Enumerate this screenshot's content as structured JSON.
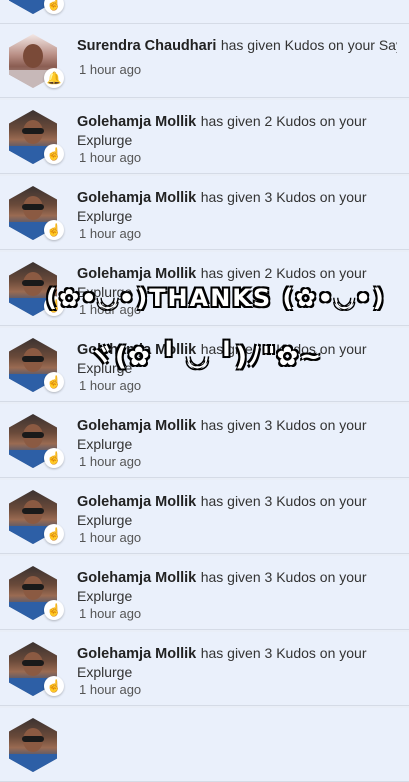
{
  "notifications": [
    {
      "name": "",
      "action": "",
      "target": "",
      "time": ""
    },
    {
      "name": "Surendra Chaudhari",
      "action": "has given Kudos on your Say",
      "target": "",
      "time": "1 hour ago",
      "avatar": "alt"
    },
    {
      "name": "Golehamja Mollik",
      "action": "has given 2 Kudos on your",
      "target": "Explurge",
      "time": "1 hour ago"
    },
    {
      "name": "Golehamja Mollik",
      "action": "has given 3 Kudos on your",
      "target": "Explurge",
      "time": "1 hour ago"
    },
    {
      "name": "Golehamja Mollik",
      "action": "has given 2 Kudos on your",
      "target": "Explurge",
      "time": "1 hour ago"
    },
    {
      "name": "Golehamja Mollik",
      "action": "has given 2 Kudos on your",
      "target": "Explurge",
      "time": "1 hour ago"
    },
    {
      "name": "Golehamja Mollik",
      "action": "has given 3 Kudos on your",
      "target": "Explurge",
      "time": "1 hour ago"
    },
    {
      "name": "Golehamja Mollik",
      "action": "has given 3 Kudos on your",
      "target": "Explurge",
      "time": "1 hour ago"
    },
    {
      "name": "Golehamja Mollik",
      "action": "has given 3 Kudos on your",
      "target": "Explurge",
      "time": "1 hour ago"
    },
    {
      "name": "Golehamja Mollik",
      "action": "has given 3 Kudos on your",
      "target": "Explurge",
      "time": "1 hour ago"
    }
  ],
  "overlay": {
    "line1": "(✿•◡•)THANKS (✿•◡•)",
    "line2": "ヾ(✿ ╹ ◡ ╹)ﾉ\"✿~"
  }
}
